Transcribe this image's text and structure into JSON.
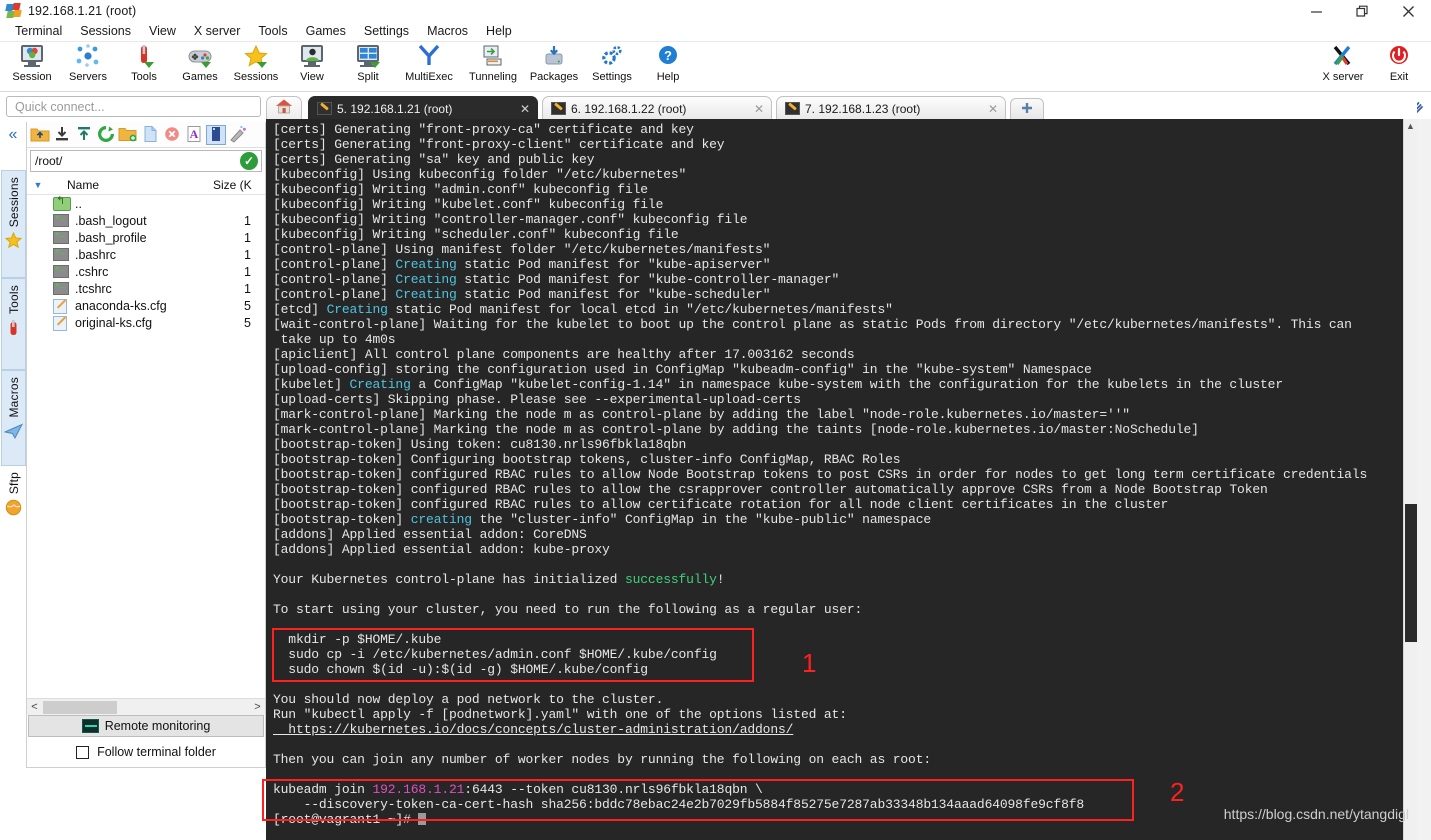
{
  "window": {
    "title": "192.168.1.21 (root)",
    "app_icon": "mobaxterm-icon",
    "controls": [
      {
        "name": "minimize-button",
        "glyph": "minimize-icon"
      },
      {
        "name": "restore-button",
        "glyph": "restore-icon"
      },
      {
        "name": "close-button",
        "glyph": "close-icon"
      }
    ]
  },
  "menubar": {
    "items": [
      "Terminal",
      "Sessions",
      "View",
      "X server",
      "Tools",
      "Games",
      "Settings",
      "Macros",
      "Help"
    ]
  },
  "toolbar": {
    "buttons": [
      {
        "label": "Session",
        "icon": "session-icon"
      },
      {
        "label": "Servers",
        "icon": "servers-icon"
      },
      {
        "label": "Tools",
        "icon": "tools-icon"
      },
      {
        "label": "Games",
        "icon": "games-icon"
      },
      {
        "label": "Sessions",
        "icon": "sessions-star-icon"
      },
      {
        "label": "View",
        "icon": "view-icon"
      },
      {
        "label": "Split",
        "icon": "split-icon"
      },
      {
        "label": "MultiExec",
        "icon": "multiexec-icon"
      },
      {
        "label": "Tunneling",
        "icon": "tunneling-icon"
      },
      {
        "label": "Packages",
        "icon": "packages-icon"
      },
      {
        "label": "Settings",
        "icon": "settings-gear-icon"
      },
      {
        "label": "Help",
        "icon": "help-question-icon"
      }
    ],
    "right_buttons": [
      {
        "label": "X server",
        "icon": "xserver-icon"
      },
      {
        "label": "Exit",
        "icon": "exit-power-icon"
      }
    ]
  },
  "quick_connect": {
    "placeholder": "Quick connect..."
  },
  "side_strip": {
    "collapse_icon": "chevron-double-left-icon",
    "tabs": [
      {
        "label": "Sessions",
        "icon": "star-icon"
      },
      {
        "label": "Tools",
        "icon": "swiss-knife-icon"
      },
      {
        "label": "Macros",
        "icon": "paper-plane-icon"
      },
      {
        "label": "Sftp",
        "icon": "globe-icon"
      }
    ]
  },
  "sftp": {
    "toolbar_icons": [
      "up-folder-icon",
      "download-icon",
      "upload-icon",
      "refresh-icon",
      "new-folder-icon",
      "new-file-icon",
      "delete-icon",
      "text-mode-icon",
      "binary-mode-icon",
      "permissions-icon"
    ],
    "path": "/root/",
    "path_ok_icon": "check-circle-icon",
    "columns": [
      "Name",
      "Size (K"
    ],
    "rows": [
      {
        "icon": "up-dir-icon",
        "name": "..",
        "size": ""
      },
      {
        "icon": "terminal-file-icon",
        "name": ".bash_logout",
        "size": "1"
      },
      {
        "icon": "terminal-file-icon",
        "name": ".bash_profile",
        "size": "1"
      },
      {
        "icon": "terminal-file-icon",
        "name": ".bashrc",
        "size": "1"
      },
      {
        "icon": "terminal-file-icon",
        "name": ".cshrc",
        "size": "1"
      },
      {
        "icon": "terminal-file-icon",
        "name": ".tcshrc",
        "size": "1"
      },
      {
        "icon": "config-file-icon",
        "name": "anaconda-ks.cfg",
        "size": "5"
      },
      {
        "icon": "config-file-icon",
        "name": "original-ks.cfg",
        "size": "5"
      }
    ],
    "remote_monitoring_label": "Remote monitoring",
    "follow_folder_label": "Follow terminal folder",
    "follow_folder_checked": false
  },
  "tabs": {
    "home_icon": "home-icon",
    "add_label": "+",
    "items": [
      {
        "label": "5. 192.168.1.21 (root)",
        "active": true,
        "close_icon": "close-icon"
      },
      {
        "label": "6. 192.168.1.22 (root)",
        "active": false,
        "close_icon": "close-icon"
      },
      {
        "label": "7. 192.168.1.23 (root)",
        "active": false,
        "close_icon": "close-icon"
      }
    ]
  },
  "terminal": {
    "lines": [
      [
        {
          "t": "[certs] Generating \"front-proxy-ca\" certificate and key"
        }
      ],
      [
        {
          "t": "[certs] Generating \"front-proxy-client\" certificate and key"
        }
      ],
      [
        {
          "t": "[certs] Generating \"sa\" key and public key"
        }
      ],
      [
        {
          "t": "[kubeconfig] Using kubeconfig folder \"/etc/kubernetes\""
        }
      ],
      [
        {
          "t": "[kubeconfig] Writing \"admin.conf\" kubeconfig file"
        }
      ],
      [
        {
          "t": "[kubeconfig] Writing \"kubelet.conf\" kubeconfig file"
        }
      ],
      [
        {
          "t": "[kubeconfig] Writing \"controller-manager.conf\" kubeconfig file"
        }
      ],
      [
        {
          "t": "[kubeconfig] Writing \"scheduler.conf\" kubeconfig file"
        }
      ],
      [
        {
          "t": "[control-plane] Using manifest folder \"/etc/kubernetes/manifests\""
        }
      ],
      [
        {
          "t": "[control-plane] "
        },
        {
          "t": "Creating",
          "c": "cyan"
        },
        {
          "t": " static Pod manifest for \"kube-apiserver\""
        }
      ],
      [
        {
          "t": "[control-plane] "
        },
        {
          "t": "Creating",
          "c": "cyan"
        },
        {
          "t": " static Pod manifest for \"kube-controller-manager\""
        }
      ],
      [
        {
          "t": "[control-plane] "
        },
        {
          "t": "Creating",
          "c": "cyan"
        },
        {
          "t": " static Pod manifest for \"kube-scheduler\""
        }
      ],
      [
        {
          "t": "[etcd] "
        },
        {
          "t": "Creating",
          "c": "cyan"
        },
        {
          "t": " static Pod manifest for local etcd in \"/etc/kubernetes/manifests\""
        }
      ],
      [
        {
          "t": "[wait-control-plane] Waiting for the kubelet to boot up the control plane as static Pods from directory \"/etc/kubernetes/manifests\". This can"
        }
      ],
      [
        {
          "t": " take up to 4m0s"
        }
      ],
      [
        {
          "t": "[apiclient] All control plane components are healthy after 17.003162 seconds"
        }
      ],
      [
        {
          "t": "[upload-config] storing the configuration used in ConfigMap \"kubeadm-config\" in the \"kube-system\" Namespace"
        }
      ],
      [
        {
          "t": "[kubelet] "
        },
        {
          "t": "Creating",
          "c": "cyan"
        },
        {
          "t": " a ConfigMap \"kubelet-config-1.14\" in namespace kube-system with the configuration for the kubelets in the cluster"
        }
      ],
      [
        {
          "t": "[upload-certs] Skipping phase. Please see --experimental-upload-certs"
        }
      ],
      [
        {
          "t": "[mark-control-plane] Marking the node m as control-plane by adding the label \"node-role.kubernetes.io/master=''\""
        }
      ],
      [
        {
          "t": "[mark-control-plane] Marking the node m as control-plane by adding the taints [node-role.kubernetes.io/master:NoSchedule]"
        }
      ],
      [
        {
          "t": "[bootstrap-token] Using token: cu8130.nrls96fbkla18qbn"
        }
      ],
      [
        {
          "t": "[bootstrap-token] Configuring bootstrap tokens, cluster-info ConfigMap, RBAC Roles"
        }
      ],
      [
        {
          "t": "[bootstrap-token] configured RBAC rules to allow Node Bootstrap tokens to post CSRs in order for nodes to get long term certificate credentials"
        }
      ],
      [
        {
          "t": "[bootstrap-token] configured RBAC rules to allow the csrapprover controller automatically approve CSRs from a Node Bootstrap Token"
        }
      ],
      [
        {
          "t": "[bootstrap-token] configured RBAC rules to allow certificate rotation for all node client certificates in the cluster"
        }
      ],
      [
        {
          "t": "[bootstrap-token] "
        },
        {
          "t": "creating",
          "c": "cyan"
        },
        {
          "t": " the \"cluster-info\" ConfigMap in the \"kube-public\" namespace"
        }
      ],
      [
        {
          "t": "[addons] Applied essential addon: CoreDNS"
        }
      ],
      [
        {
          "t": "[addons] Applied essential addon: kube-proxy"
        }
      ],
      [
        {
          "t": ""
        }
      ],
      [
        {
          "t": "Your Kubernetes control-plane has initialized "
        },
        {
          "t": "successfully",
          "c": "green"
        },
        {
          "t": "!"
        }
      ],
      [
        {
          "t": ""
        }
      ],
      [
        {
          "t": "To start using your cluster, you need to run the following as a regular user:"
        }
      ],
      [
        {
          "t": ""
        }
      ],
      [
        {
          "t": "  mkdir -p $HOME/.kube"
        }
      ],
      [
        {
          "t": "  sudo cp -i /etc/kubernetes/admin.conf $HOME/.kube/config"
        }
      ],
      [
        {
          "t": "  sudo chown $(id -u):$(id -g) $HOME/.kube/config"
        }
      ],
      [
        {
          "t": ""
        }
      ],
      [
        {
          "t": "You should now deploy a pod network to the cluster."
        }
      ],
      [
        {
          "t": "Run \"kubectl apply -f [podnetwork].yaml\" with one of the options listed at:"
        }
      ],
      [
        {
          "t": "  https://kubernetes.io/docs/concepts/cluster-administration/addons/",
          "c": "under"
        }
      ],
      [
        {
          "t": ""
        }
      ],
      [
        {
          "t": "Then you can join any number of worker nodes by running the following on each as root:"
        }
      ],
      [
        {
          "t": ""
        }
      ],
      [
        {
          "t": "kubeadm join "
        },
        {
          "t": "192.168.1.21",
          "c": "magenta"
        },
        {
          "t": ":6443 --token cu8130.nrls96fbkla18qbn \\"
        }
      ],
      [
        {
          "t": "    --discovery-token-ca-cert-hash sha256:bddc78ebac24e2b7029fb5884f85275e7287ab33348b134aaad64098fe9cf8f8"
        }
      ],
      [
        {
          "t": "[root@vagrant1 ~]# ",
          "cursor": true
        }
      ]
    ]
  },
  "annotations": [
    {
      "label": "1",
      "name": "annotation-1"
    },
    {
      "label": "2",
      "name": "annotation-2"
    }
  ],
  "watermark": {
    "text": "https://blog.csdn.net/ytangdigl"
  },
  "colors": {
    "terminal_bg": "#262626",
    "terminal_fg": "#e6e6e6",
    "cyan": "#4fc3e0",
    "green": "#3fd07a",
    "magenta": "#e24fc0",
    "annotation_red": "#ff2020",
    "active_tab_bg": "#2b2b2b"
  }
}
